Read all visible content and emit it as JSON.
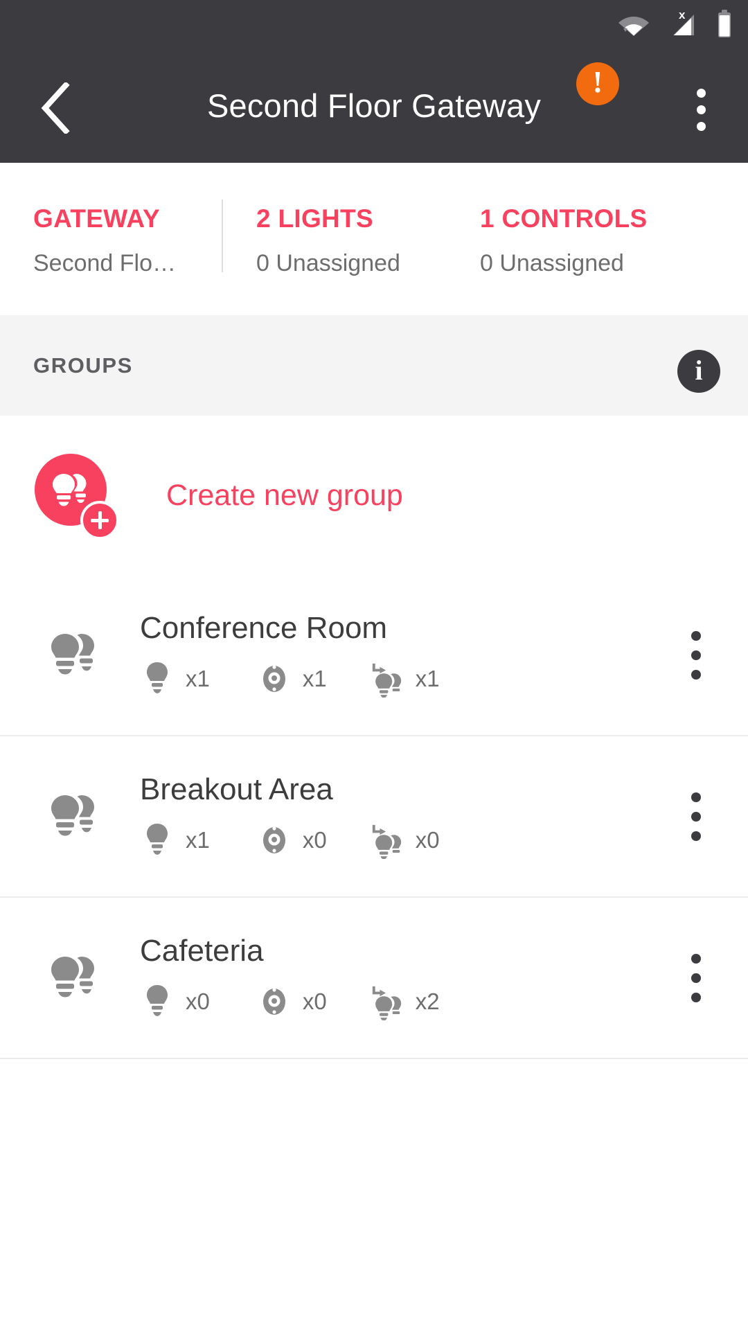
{
  "statusbar": {
    "icons": [
      "wifi-transfer-icon",
      "cellular-no-sim-icon",
      "battery-icon"
    ]
  },
  "appbar": {
    "back_icon": "chevron-left-icon",
    "title": "Second Floor Gateway",
    "warning_icon": "warning-exclamation-icon",
    "overflow_icon": "overflow-menu-icon"
  },
  "summary": {
    "gateway": {
      "title": "GATEWAY",
      "subtitle": "Second Flo…"
    },
    "lights": {
      "title": "2 LIGHTS",
      "subtitle": "0 Unassigned"
    },
    "controls": {
      "title": "1 CONTROLS",
      "subtitle": "0 Unassigned"
    }
  },
  "groups_header": {
    "label": "GROUPS",
    "info_icon": "info-icon",
    "info_glyph": "i"
  },
  "create_group": {
    "label": "Create new group",
    "icon": "add-group-bulbs-icon"
  },
  "groups": [
    {
      "name": "Conference Room",
      "icon": "group-bulbs-icon",
      "counts": [
        {
          "icon": "light-bulb-icon",
          "value": "x1"
        },
        {
          "icon": "dial-control-icon",
          "value": "x1"
        },
        {
          "icon": "scene-assign-icon",
          "value": "x1"
        }
      ],
      "overflow_icon": "overflow-menu-icon"
    },
    {
      "name": "Breakout Area",
      "icon": "group-bulbs-icon",
      "counts": [
        {
          "icon": "light-bulb-icon",
          "value": "x1"
        },
        {
          "icon": "dial-control-icon",
          "value": "x0"
        },
        {
          "icon": "scene-assign-icon",
          "value": "x0"
        }
      ],
      "overflow_icon": "overflow-menu-icon"
    },
    {
      "name": "Cafeteria",
      "icon": "group-bulbs-icon",
      "counts": [
        {
          "icon": "light-bulb-icon",
          "value": "x0"
        },
        {
          "icon": "dial-control-icon",
          "value": "x0"
        },
        {
          "icon": "scene-assign-icon",
          "value": "x2"
        }
      ],
      "overflow_icon": "overflow-menu-icon"
    }
  ],
  "colors": {
    "accent": "#f8405f",
    "header_bg": "#3b3b40",
    "band_bg": "#f4f4f4",
    "warning": "#f26b0f",
    "muted_text": "#6d6d6d",
    "icon_grey": "#8b8b8b"
  }
}
